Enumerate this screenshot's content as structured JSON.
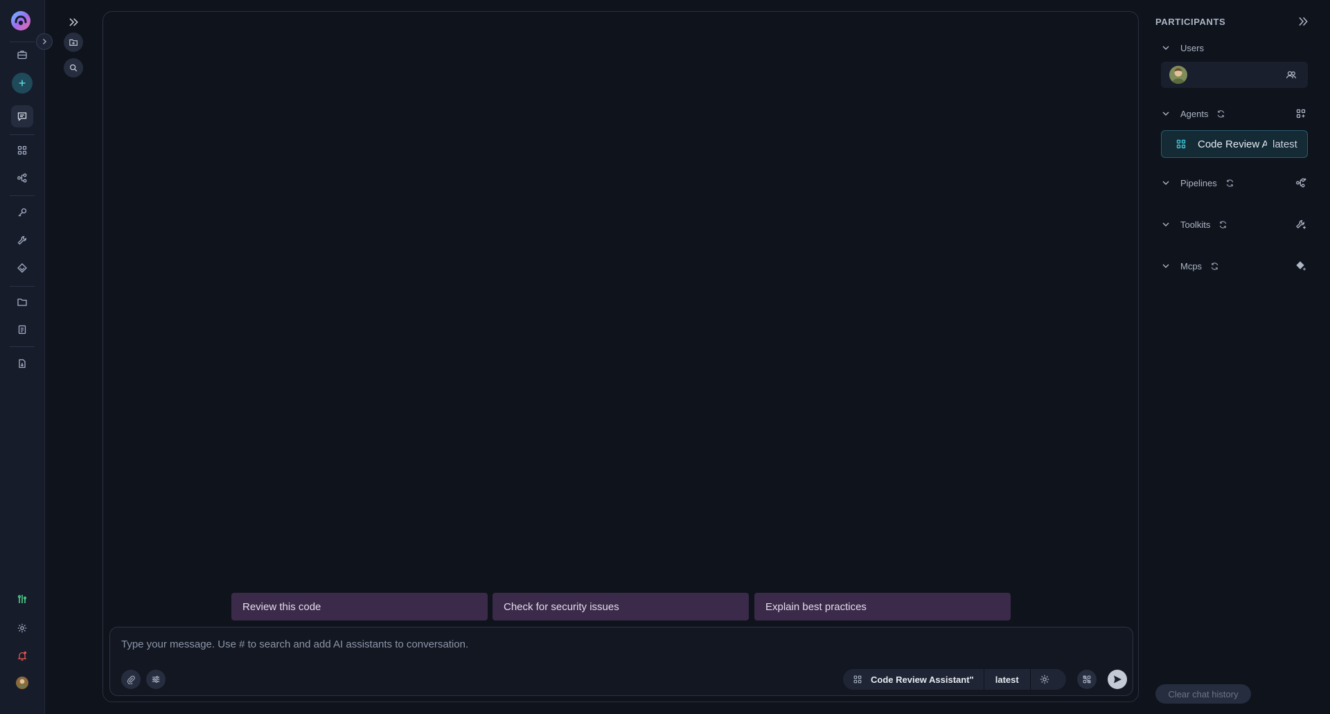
{
  "chat": {
    "suggestions": [
      "Review this code",
      "Check for security issues",
      "Explain best practices"
    ],
    "composer": {
      "placeholder": "Type your message. Use # to search and add AI assistants to conversation.",
      "value": "",
      "agent_name": "Code Review Assistant\"",
      "agent_version": "latest"
    }
  },
  "participants": {
    "title": "PARTICIPANTS",
    "sections": {
      "users": {
        "label": "Users"
      },
      "agents": {
        "label": "Agents",
        "items": [
          {
            "name": "Code Review Assistant\"",
            "version": "latest"
          }
        ]
      },
      "pipelines": {
        "label": "Pipelines"
      },
      "toolkits": {
        "label": "Toolkits"
      },
      "mcps": {
        "label": "Mcps"
      }
    },
    "clear_label": "Clear chat history"
  },
  "icons": {
    "rail": [
      "briefcase-icon",
      "plus-icon",
      "chat-icon",
      "grid-icon",
      "pipeline-icon",
      "key-icon",
      "wrench-icon",
      "tag-icon",
      "folder-icon",
      "document-icon",
      "file-download-icon",
      "activity-icon",
      "settings-icon",
      "bell-icon"
    ],
    "colors": {
      "accent": "#3fc1d1",
      "suggestion_bg": "#3b2a49",
      "background": "#0f131c"
    }
  }
}
